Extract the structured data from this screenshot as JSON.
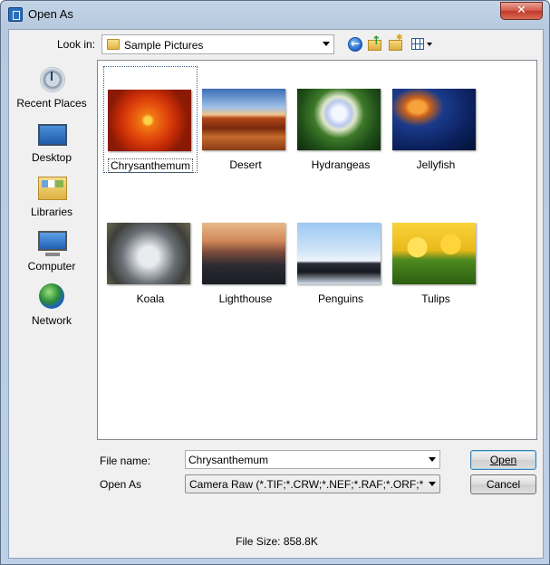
{
  "window": {
    "title": "Open As",
    "close_symbol": "✕"
  },
  "lookin": {
    "label": "Look in:",
    "value": "Sample Pictures"
  },
  "places": [
    {
      "label": "Recent Places",
      "icon": "recent-places-icon"
    },
    {
      "label": "Desktop",
      "icon": "desktop-icon"
    },
    {
      "label": "Libraries",
      "icon": "libraries-icon"
    },
    {
      "label": "Computer",
      "icon": "computer-icon"
    },
    {
      "label": "Network",
      "icon": "network-icon"
    }
  ],
  "files": [
    {
      "name": "Chrysanthemum",
      "selected": true
    },
    {
      "name": "Desert"
    },
    {
      "name": "Hydrangeas"
    },
    {
      "name": "Jellyfish"
    },
    {
      "name": "Koala"
    },
    {
      "name": "Lighthouse"
    },
    {
      "name": "Penguins"
    },
    {
      "name": "Tulips"
    }
  ],
  "filename": {
    "label": "File name:",
    "value": "Chrysanthemum"
  },
  "openas": {
    "label": "Open As",
    "value": "Camera Raw (*.TIF;*.CRW;*.NEF;*.RAF;*.ORF;*.MRW"
  },
  "buttons": {
    "open": "Open",
    "cancel": "Cancel"
  },
  "status": {
    "file_size": "File Size: 858.8K"
  }
}
